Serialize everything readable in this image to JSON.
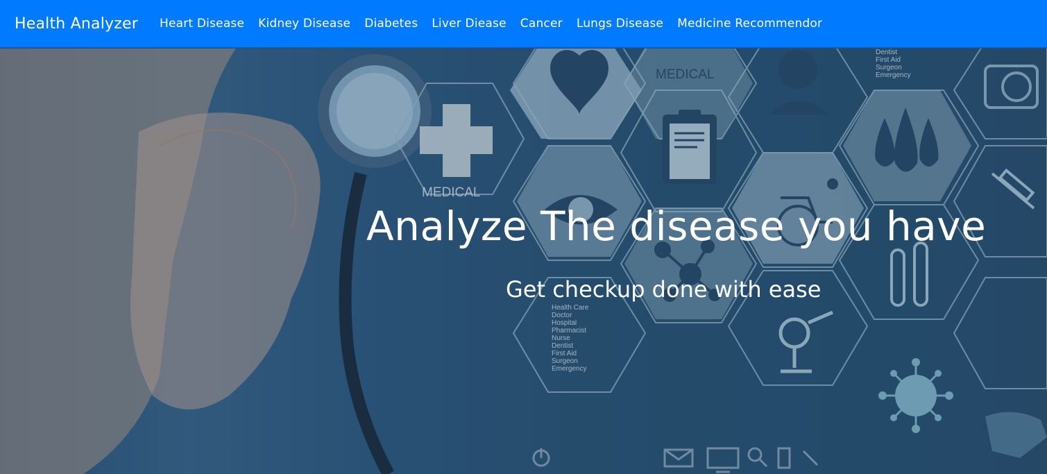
{
  "navbar": {
    "brand": "Health Analyzer",
    "items": [
      {
        "label": "Heart Disease"
      },
      {
        "label": "Kidney Disease"
      },
      {
        "label": "Diabetes"
      },
      {
        "label": "Liver Diease"
      },
      {
        "label": "Cancer"
      },
      {
        "label": "Lungs Disease"
      },
      {
        "label": "Medicine Recommendor"
      }
    ],
    "background_color": "#007bff"
  },
  "hero": {
    "title": "Analyze The disease you have",
    "subtitle": "Get checkup done with ease",
    "image_labels": {
      "medical_1": "MEDICAL",
      "medical_2": "MEDICAL",
      "roles_list": [
        "Health Care",
        "Doctor",
        "Hospital",
        "Pharmacist",
        "Nurse",
        "Dentist",
        "First Aid",
        "Surgeon",
        "Emergency"
      ],
      "roles_list_top": [
        "Dentist",
        "First Aid",
        "Surgeon",
        "Emergency"
      ]
    },
    "icons": [
      "heart-icon",
      "doctor-icon",
      "medical-cross-icon",
      "clipboard-icon",
      "eye-icon",
      "blood-drops-icon",
      "wheelchair-icon",
      "syringe-icon",
      "molecule-icon",
      "test-tubes-icon",
      "microscope-icon",
      "virus-icon",
      "first-aid-kit-icon",
      "power-icon",
      "mail-icon",
      "monitor-icon",
      "search-icon",
      "phone-icon",
      "tool-icon"
    ]
  }
}
